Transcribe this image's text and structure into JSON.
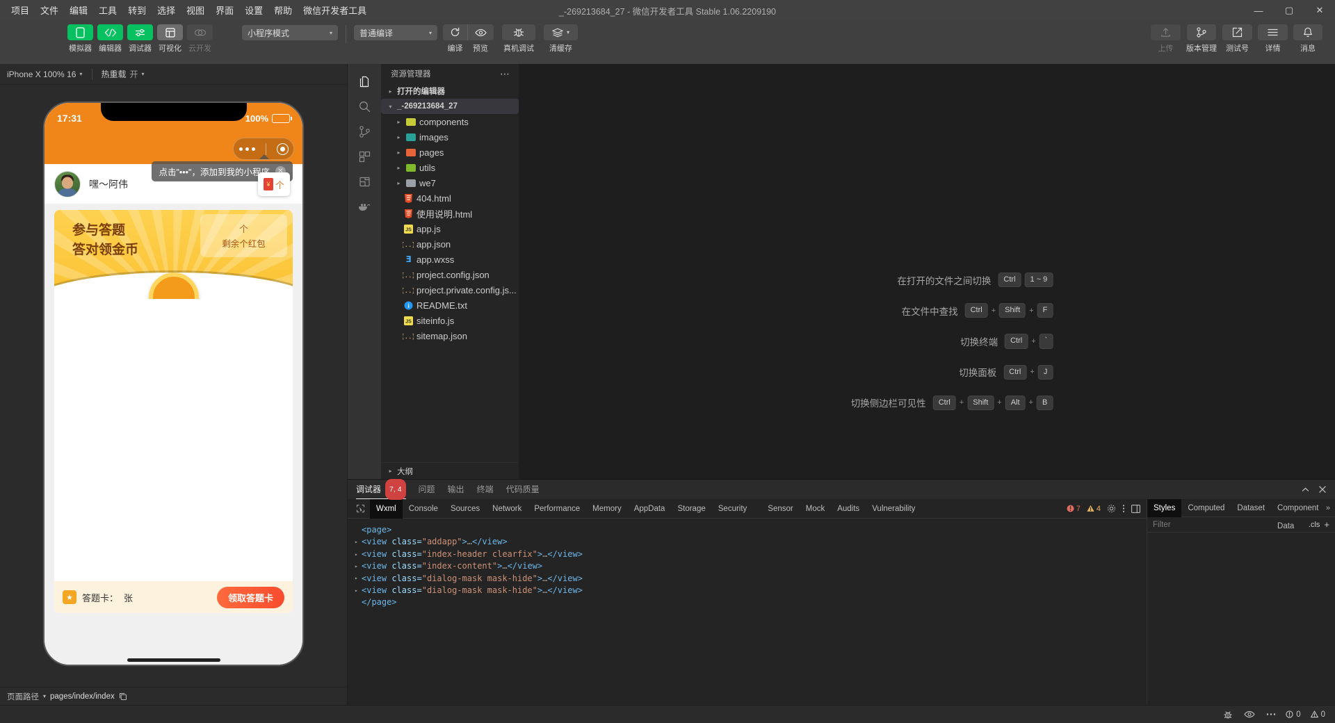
{
  "window": {
    "title": "_-269213684_27  -  微信开发者工具 Stable 1.06.2209190",
    "menus": [
      "项目",
      "文件",
      "编辑",
      "工具",
      "转到",
      "选择",
      "视图",
      "界面",
      "设置",
      "帮助",
      "微信开发者工具"
    ],
    "controls": {
      "minimize": "—",
      "maximize": "▢",
      "close": "✕"
    }
  },
  "toolbar": {
    "modes": [
      {
        "label": "模拟器",
        "icon": "phone-icon",
        "state": "green"
      },
      {
        "label": "编辑器",
        "icon": "code-icon",
        "state": "green"
      },
      {
        "label": "调试器",
        "icon": "sliders-icon",
        "state": "green"
      },
      {
        "label": "可视化",
        "icon": "layout-icon",
        "state": "grey"
      },
      {
        "label": "云开发",
        "icon": "cloud-icon",
        "state": "dim"
      }
    ],
    "mode_select": {
      "value": "小程序模式",
      "caret": "▾"
    },
    "compile_select": {
      "value": "普通编译",
      "caret": "▾"
    },
    "actions": [
      {
        "label": "编译",
        "icon": "refresh-icon"
      },
      {
        "label": "预览",
        "icon": "eye-icon"
      },
      {
        "label": "真机调试",
        "icon": "bug-icon"
      },
      {
        "label": "清缓存",
        "icon": "layers-icon",
        "caret": "▾"
      }
    ],
    "right_actions": [
      {
        "label": "上传",
        "icon": "upload-icon",
        "disabled": true
      },
      {
        "label": "版本管理",
        "icon": "git-branch-icon",
        "disabled": false
      },
      {
        "label": "测试号",
        "icon": "external-link-icon",
        "disabled": false
      },
      {
        "label": "详情",
        "icon": "menu-icon",
        "disabled": false
      },
      {
        "label": "消息",
        "icon": "bell-icon",
        "disabled": false
      }
    ]
  },
  "simulator": {
    "device_select": "iPhone X 100% 16",
    "device_caret": "▾",
    "hotreload_label": "热重载",
    "hotreload_value": "开",
    "hotreload_caret": "▾",
    "phone": {
      "status_time": "17:31",
      "battery_text": "100%",
      "user_name": "嘿～阿伟",
      "tip_text": "点击\"•••\"，添加到我的小程序",
      "tip_close": "✕",
      "mini_card_arrow": "个",
      "hero_title_line1": "参与答题",
      "hero_title_line2": "答对领金币",
      "hero_box_arrow": "个",
      "hero_box_text": "剩余个红包",
      "footer_label": "答题卡：",
      "footer_value": "张",
      "footer_button": "领取答题卡"
    },
    "footer": {
      "path_label": "页面路径",
      "path_caret": "▾",
      "path_value": "pages/index/index",
      "copy_icon": "copy-icon"
    }
  },
  "activity_bar": {
    "items": [
      {
        "name": "explorer",
        "icon": "files-icon",
        "active": true
      },
      {
        "name": "search",
        "icon": "search-icon",
        "active": false
      },
      {
        "name": "source-control",
        "icon": "git-branch-icon",
        "active": false
      },
      {
        "name": "extensions",
        "icon": "extensions-icon",
        "active": false
      },
      {
        "name": "layout",
        "icon": "layout-icon",
        "active": false
      },
      {
        "name": "docker",
        "icon": "docker-icon",
        "active": false
      }
    ]
  },
  "explorer": {
    "title": "资源管理器",
    "more": "⋯",
    "open_editors": {
      "label": "打开的编辑器",
      "caret": "▸"
    },
    "project": {
      "label": "_-269213684_27",
      "caret": "▾"
    },
    "tree": [
      {
        "label": "components",
        "type": "folder",
        "color": "#c6cc39",
        "caret": "▸"
      },
      {
        "label": "images",
        "type": "folder",
        "color": "#2aa198",
        "caret": "▸"
      },
      {
        "label": "pages",
        "type": "folder",
        "color": "#e8633a",
        "caret": "▸"
      },
      {
        "label": "utils",
        "type": "folder",
        "color": "#7db82d",
        "caret": "▸"
      },
      {
        "label": "we7",
        "type": "folder",
        "color": "#9aa0a6",
        "caret": "▸"
      },
      {
        "label": "404.html",
        "type": "html",
        "color": "#e44d26",
        "caret": ""
      },
      {
        "label": "使用说明.html",
        "type": "html",
        "color": "#e44d26",
        "caret": ""
      },
      {
        "label": "app.js",
        "type": "js",
        "color": "#f0db4f",
        "caret": ""
      },
      {
        "label": "app.json",
        "type": "json",
        "color": "#f0c674",
        "caret": ""
      },
      {
        "label": "app.wxss",
        "type": "css",
        "color": "#42a5f5",
        "caret": ""
      },
      {
        "label": "project.config.json",
        "type": "json",
        "color": "#f0c674",
        "caret": ""
      },
      {
        "label": "project.private.config.js...",
        "type": "json",
        "color": "#f0c674",
        "caret": ""
      },
      {
        "label": "README.txt",
        "type": "info",
        "color": "#42a5f5",
        "caret": ""
      },
      {
        "label": "siteinfo.js",
        "type": "js",
        "color": "#f0db4f",
        "caret": ""
      },
      {
        "label": "sitemap.json",
        "type": "json",
        "color": "#f0c674",
        "caret": ""
      }
    ],
    "outline": {
      "label": "大纲",
      "caret": "▸"
    }
  },
  "welcome": {
    "shortcuts": [
      {
        "label": "在打开的文件之间切换",
        "keys": [
          "Ctrl",
          "1 ~ 9"
        ],
        "separators": [
          ""
        ]
      },
      {
        "label": "在文件中查找",
        "keys": [
          "Ctrl",
          "Shift",
          "F"
        ],
        "separators": [
          "+",
          "+"
        ]
      },
      {
        "label": "切换终端",
        "keys": [
          "Ctrl",
          "`"
        ],
        "separators": [
          "+"
        ]
      },
      {
        "label": "切换面板",
        "keys": [
          "Ctrl",
          "J"
        ],
        "separators": [
          "+"
        ]
      },
      {
        "label": "切换侧边栏可见性",
        "keys": [
          "Ctrl",
          "Shift",
          "Alt",
          "B"
        ],
        "separators": [
          "+",
          "+",
          "+"
        ]
      }
    ]
  },
  "panel": {
    "tabs": [
      {
        "label": "调试器",
        "badge": "7, 4",
        "active": true
      },
      {
        "label": "问题",
        "badge": "",
        "active": false
      },
      {
        "label": "输出",
        "badge": "",
        "active": false
      },
      {
        "label": "终端",
        "badge": "",
        "active": false
      },
      {
        "label": "代码质量",
        "badge": "",
        "active": false
      }
    ],
    "collapse_icon": "chevron-up-icon",
    "close_icon": "close-icon"
  },
  "devtools": {
    "picker_icon": "inspect-icon",
    "tabs": [
      {
        "label": "Wxml",
        "active": true
      },
      {
        "label": "Console",
        "active": false
      },
      {
        "label": "Sources",
        "active": false
      },
      {
        "label": "Network",
        "active": false
      },
      {
        "label": "Performance",
        "active": false
      },
      {
        "label": "Memory",
        "active": false
      },
      {
        "label": "AppData",
        "active": false
      },
      {
        "label": "Storage",
        "active": false
      },
      {
        "label": "Security",
        "active": false
      },
      {
        "label": "Sensor",
        "active": false
      },
      {
        "label": "Mock",
        "active": false
      },
      {
        "label": "Audits",
        "active": false
      },
      {
        "label": "Vulnerability",
        "active": false
      }
    ],
    "error_count": "7",
    "warning_count": "4",
    "settings_icon": "gear-icon",
    "more_icon": "more-vertical-icon",
    "dock_icon": "dock-icon",
    "wxml": [
      {
        "indent": 0,
        "caret": "",
        "text": "<page>",
        "kind": "tag"
      },
      {
        "indent": 1,
        "caret": "▸",
        "tag_open": "<view ",
        "attr": "class=",
        "value": "\"addapp\"",
        "tag_rest": ">",
        "ellipsis": "…",
        "tag_close": "</view>"
      },
      {
        "indent": 1,
        "caret": "▸",
        "tag_open": "<view ",
        "attr": "class=",
        "value": "\"index-header clearfix\"",
        "tag_rest": ">",
        "ellipsis": "…",
        "tag_close": "</view>"
      },
      {
        "indent": 1,
        "caret": "▸",
        "tag_open": "<view ",
        "attr": "class=",
        "value": "\"index-content\"",
        "tag_rest": ">",
        "ellipsis": "…",
        "tag_close": "</view>"
      },
      {
        "indent": 1,
        "caret": "▸",
        "tag_open": "<view ",
        "attr": "class=",
        "value": "\"dialog-mask mask-hide\"",
        "tag_rest": ">",
        "ellipsis": "…",
        "tag_close": "</view>"
      },
      {
        "indent": 1,
        "caret": "▸",
        "tag_open": "<view ",
        "attr": "class=",
        "value": "\"dialog-mask mask-hide\"",
        "tag_rest": ">",
        "ellipsis": "…",
        "tag_close": "</view>"
      },
      {
        "indent": 0,
        "caret": "",
        "text": "</page>",
        "kind": "tag"
      }
    ],
    "sidebar": {
      "tabs": [
        {
          "label": "Styles",
          "active": true
        },
        {
          "label": "Computed",
          "active": false
        },
        {
          "label": "Dataset",
          "active": false
        },
        {
          "label": "Component Data",
          "active": false
        }
      ],
      "more": "»",
      "filter_placeholder": "Filter",
      "cls_label": ".cls",
      "plus_label": "+"
    }
  },
  "statusbar": {
    "errors": "0",
    "warnings": "0",
    "error_icon": "error-icon",
    "warning_icon": "warning-icon",
    "icons": [
      "bug-icon",
      "eye-icon",
      "more-icon"
    ]
  },
  "colors": {
    "accent_green": "#07c160",
    "badge_red": "#d0423f",
    "brand_orange": "#f08519",
    "hero_yellow": "#fcc232",
    "cta_red": "#f84c2e"
  }
}
